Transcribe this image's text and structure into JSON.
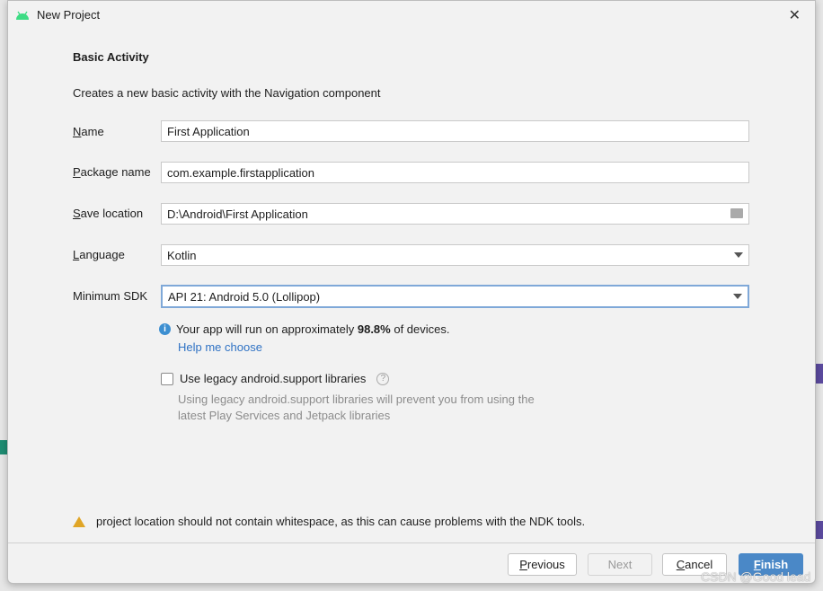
{
  "window": {
    "title": "New Project",
    "close_icon": "close-icon",
    "logo_icon": "android-icon"
  },
  "template": {
    "title": "Basic Activity",
    "description": "Creates a new basic activity with the Navigation component"
  },
  "form": {
    "name": {
      "label_u": "N",
      "label_rest": "ame",
      "value": "First Application"
    },
    "package": {
      "label_u": "P",
      "label_rest": "ackage name",
      "value": "com.example.firstapplication"
    },
    "save": {
      "label_u": "S",
      "label_rest": "ave location",
      "value": "D:\\Android\\First Application"
    },
    "language": {
      "label_u": "L",
      "label_rest": "anguage",
      "value": "Kotlin"
    },
    "min_sdk": {
      "label": "Minimum SDK",
      "value": "API 21: Android 5.0 (Lollipop)"
    }
  },
  "info": {
    "prefix": "Your app will run on approximately ",
    "percent": "98.8%",
    "suffix": " of devices.",
    "help_link": "Help me choose"
  },
  "legacy": {
    "label": "Use legacy android.support libraries",
    "checked": false,
    "note": "Using legacy android.support libraries will prevent you from using the latest Play Services and Jetpack libraries"
  },
  "warning": "project location should not contain whitespace, as this can cause problems with the NDK tools.",
  "buttons": {
    "previous_u": "P",
    "previous_rest": "revious",
    "next": "Next",
    "cancel_u": "C",
    "cancel_rest": "ancel",
    "finish_u": "F",
    "finish_rest": "inish"
  },
  "watermark": "CSDN @Good lead",
  "colors": {
    "accent": "#4a88c7",
    "link": "#2f72c4",
    "warning": "#e0a526",
    "android": "#3ddc84"
  }
}
